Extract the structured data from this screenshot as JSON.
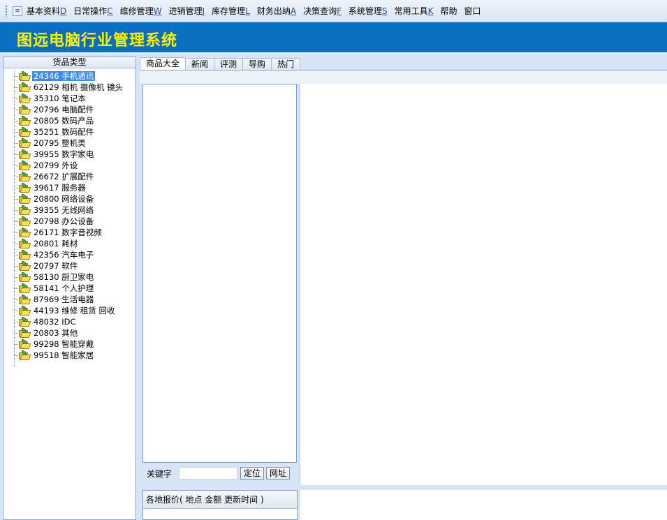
{
  "menu": {
    "icon": "window-menu-icon",
    "items": [
      {
        "label": "基本资料",
        "accel": "D"
      },
      {
        "label": "日常操作",
        "accel": "C"
      },
      {
        "label": "维修管理",
        "accel": "W"
      },
      {
        "label": "进销管理",
        "accel": "J"
      },
      {
        "label": "库存管理",
        "accel": "L"
      },
      {
        "label": "财务出纳",
        "accel": "A"
      },
      {
        "label": "决策查询",
        "accel": "F"
      },
      {
        "label": "系统管理",
        "accel": "S"
      },
      {
        "label": "常用工具",
        "accel": "K"
      },
      {
        "label": "帮助",
        "accel": ""
      },
      {
        "label": "窗口",
        "accel": ""
      }
    ]
  },
  "banner": {
    "title": "图远电脑行业管理系统",
    "bg_color": "#0a6fbe",
    "title_color": "#fff200"
  },
  "tree": {
    "header": "货品类型",
    "icon": "folder-icon",
    "items": [
      "24346 手机通讯",
      "62129 相机 摄像机 镜头",
      "35310 笔记本",
      "20796 电脑配件",
      "20805 数码产品",
      "35251 数码配件",
      "20795 整机类",
      "39955 数字家电",
      "20799 外设",
      "26672 扩展配件",
      "39617 服务器",
      "20800 网络设备",
      "39355 无线网络",
      "20798 办公设备",
      "26171 数字音视频",
      "20801 耗材",
      "42356 汽车电子",
      "20797 软件",
      "58130 厨卫家电",
      "58141 个人护理",
      "87969 生活电器",
      "44193 维修 租赁 回收",
      "48032 IDC",
      "20803 其他",
      "99298 智能穿戴",
      "99518 智能家居"
    ]
  },
  "tabs": [
    "商品大全",
    "新闻",
    "评测",
    "导购",
    "热门"
  ],
  "search": {
    "label": "关键字",
    "value": "",
    "locate_label": "定位",
    "url_label": "网址"
  },
  "price_panel": {
    "header": "各地报价( 地点 金额  更新时间 )"
  }
}
